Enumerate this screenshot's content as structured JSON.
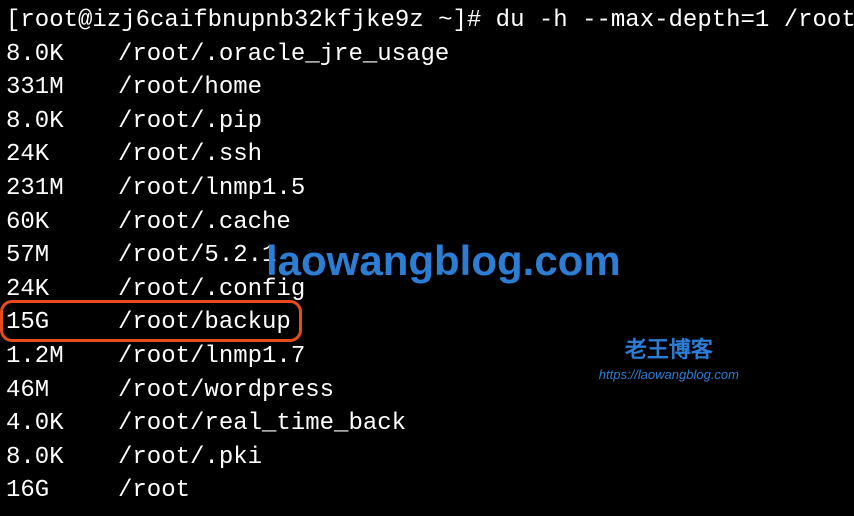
{
  "prompt": "[root@izj6caifbnupnb32kfjke9z ~]# du -h --max-depth=1 /root",
  "lines": [
    {
      "size": "8.0K",
      "path": "/root/.oracle_jre_usage"
    },
    {
      "size": "331M",
      "path": "/root/home"
    },
    {
      "size": "8.0K",
      "path": "/root/.pip"
    },
    {
      "size": "24K",
      "path": "/root/.ssh"
    },
    {
      "size": "231M",
      "path": "/root/lnmp1.5"
    },
    {
      "size": "60K",
      "path": "/root/.cache"
    },
    {
      "size": "57M",
      "path": "/root/5.2.1"
    },
    {
      "size": "24K",
      "path": "/root/.config"
    },
    {
      "size": "15G",
      "path": "/root/backup"
    },
    {
      "size": "1.2M",
      "path": "/root/lnmp1.7"
    },
    {
      "size": "46M",
      "path": "/root/wordpress"
    },
    {
      "size": "4.0K",
      "path": "/root/real_time_back"
    },
    {
      "size": "8.0K",
      "path": "/root/.pki"
    },
    {
      "size": "16G",
      "path": "/root"
    }
  ],
  "watermark": {
    "big": "laowangblog.com",
    "cn": "老王博客",
    "url": "https://laowangblog.com"
  }
}
